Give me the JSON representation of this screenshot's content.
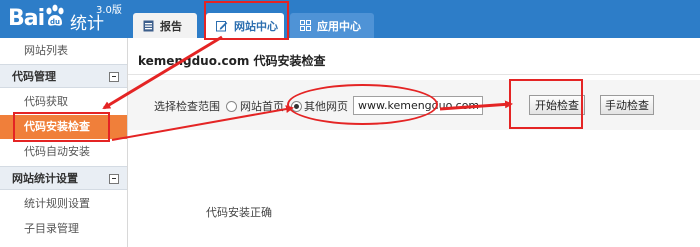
{
  "header": {
    "logo_text": "Bai",
    "logo_cn": "统计",
    "logo_version": "3.0版",
    "tabs": [
      {
        "label": "报告",
        "icon": "report-icon"
      },
      {
        "label": "网站中心",
        "icon": "edit-icon"
      },
      {
        "label": "应用中心",
        "icon": "grid-icon"
      }
    ]
  },
  "sidebar": {
    "items": [
      {
        "label": "网站列表"
      },
      {
        "label": "代码管理"
      },
      {
        "label": "代码获取"
      },
      {
        "label": "代码安装检查"
      },
      {
        "label": "代码自动安装"
      },
      {
        "label": "网站统计设置"
      },
      {
        "label": "统计规则设置"
      },
      {
        "label": "子目录管理"
      }
    ]
  },
  "main": {
    "title": "kemengduo.com 代码安装检查",
    "scope_label": "选择检查范围",
    "radio_home": "网站首页",
    "radio_other": "其他网页",
    "url_value": "www.kemengduo.com",
    "start_button": "开始检查",
    "manual_button": "手动检查",
    "result_text": "代码安装正确"
  },
  "colors": {
    "header_bg": "#2d7dc8",
    "active_item": "#f07f3a",
    "annotation": "#e42424"
  }
}
